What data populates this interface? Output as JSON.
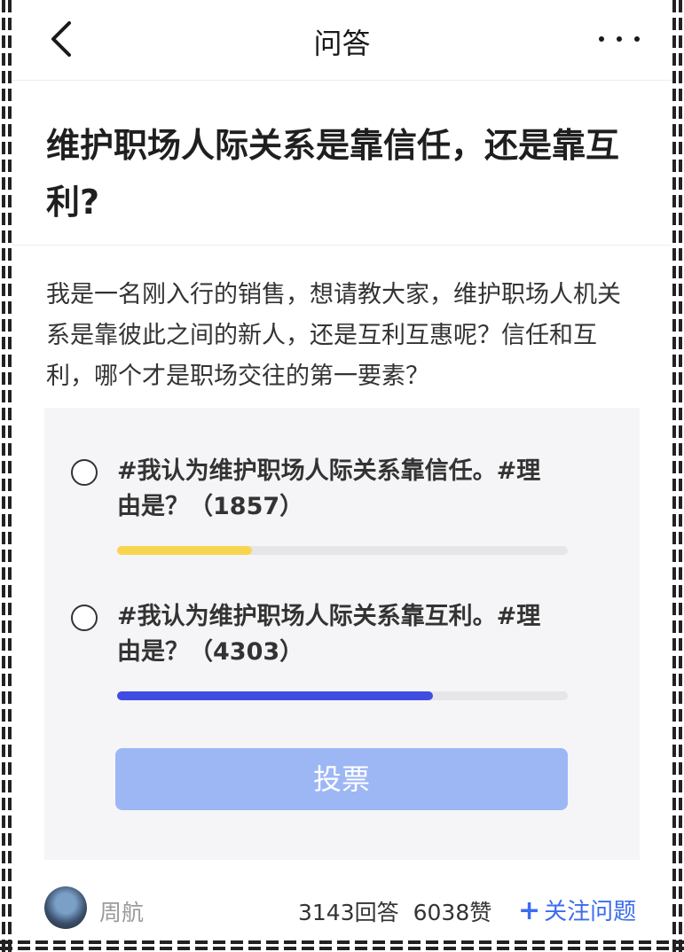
{
  "topbar": {
    "title": "问答"
  },
  "question": {
    "title": "维护职场人际关系是靠信任，还是靠互利?",
    "description": "我是一名刚入行的销售，想请教大家，维护职场人机关系是靠彼此之间的新人，还是互利互惠呢？信任和互利，哪个才是职场交往的第一要素？"
  },
  "poll": {
    "options": [
      {
        "label": "#我认为维护职场人际关系靠信任。#理由是？（1857）",
        "votes": 1857,
        "share": 0.3,
        "color": "#f7d54e"
      },
      {
        "label": "#我认为维护职场人际关系靠互利。#理由是？（4303）",
        "votes": 4303,
        "share": 0.7,
        "color": "#3f4de0"
      }
    ],
    "vote_label": "投票"
  },
  "footer": {
    "author": "周航",
    "answers": "3143回答",
    "likes": "6038赞",
    "follow_label": "关注问题"
  },
  "colors": {
    "accent": "#3b6cf0",
    "vote_button": "#9db7f5"
  }
}
